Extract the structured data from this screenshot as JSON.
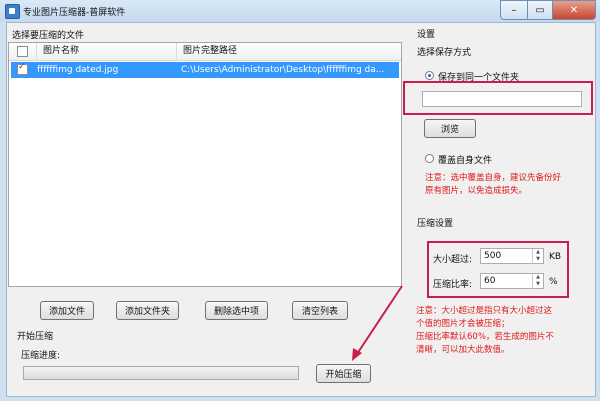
{
  "window": {
    "title": "专业图片压缩器-普屏软件"
  },
  "left": {
    "select_label": "选择要压缩的文件",
    "col_name": "图片名称",
    "col_path": "图片完整路径",
    "rows": [
      {
        "name": "ffffffimg dated.jpg",
        "path": "C:\\Users\\Administrator\\Desktop\\ffffffimg da..."
      }
    ],
    "buttons": {
      "add_file": "添加文件",
      "add_folder": "添加文件夹",
      "delete_selected": "删除选中项",
      "clear_list": "清空列表"
    },
    "start_group": "开始压缩",
    "progress_label": "压缩进度:",
    "progress_value": 0,
    "start_button": "开始压缩"
  },
  "settings": {
    "title": "设置",
    "save_mode_label": "选择保存方式",
    "save_option": "保存到同一个文件夹",
    "path_value": "",
    "browse_button": "浏览",
    "overwrite_option": "覆盖自身文件",
    "overwrite_note": [
      "注意：选中覆盖自身，建议先备份好",
      "原有图片，以免造成损失。"
    ],
    "compress_title": "压缩设置",
    "size_label": "大小超过:",
    "size_value": "500",
    "size_unit": "KB",
    "ratio_label": "压缩比率:",
    "ratio_value": "60",
    "ratio_unit": "%",
    "notes": [
      "注意：大小超过是指只有大小超过这",
      "个值的图片才会被压缩；",
      "压缩比率默认60%，若生成的图片不",
      "清晰，可以加大此数值。"
    ]
  },
  "colors": {
    "accent_red": "#e01818",
    "highlight_box": "#c81e4c",
    "selection": "#3399ff",
    "progress": "#37b34a"
  }
}
